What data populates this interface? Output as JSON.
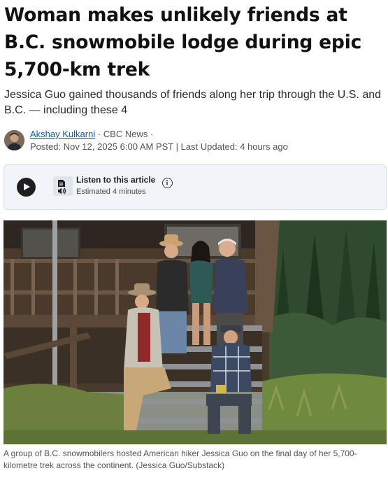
{
  "article": {
    "headline": "Woman makes unlikely friends at B.C. snowmobile lodge during epic 5,700-km trek",
    "deck": "Jessica Guo gained thousands of friends along her trip through the U.S. and B.C. — including these 4",
    "byline": {
      "author": "Akshay Kulkarni",
      "separator_1": " · ",
      "outlet": "CBC News",
      "separator_2": " ·",
      "posted": "Posted: Nov 12, 2025 6:00 AM PST | Last Updated: 4 hours ago"
    }
  },
  "listen": {
    "title": "Listen to this article",
    "estimate": "Estimated 4 minutes",
    "icons": [
      "play-icon",
      "audio-article-icon",
      "info-icon"
    ]
  },
  "photo": {
    "caption": "A group of B.C. snowmobilers hosted American hiker Jessica Guo on the final day of her 5,700-kilometre trek across the continent. (Jessica Guo/Substack)"
  }
}
